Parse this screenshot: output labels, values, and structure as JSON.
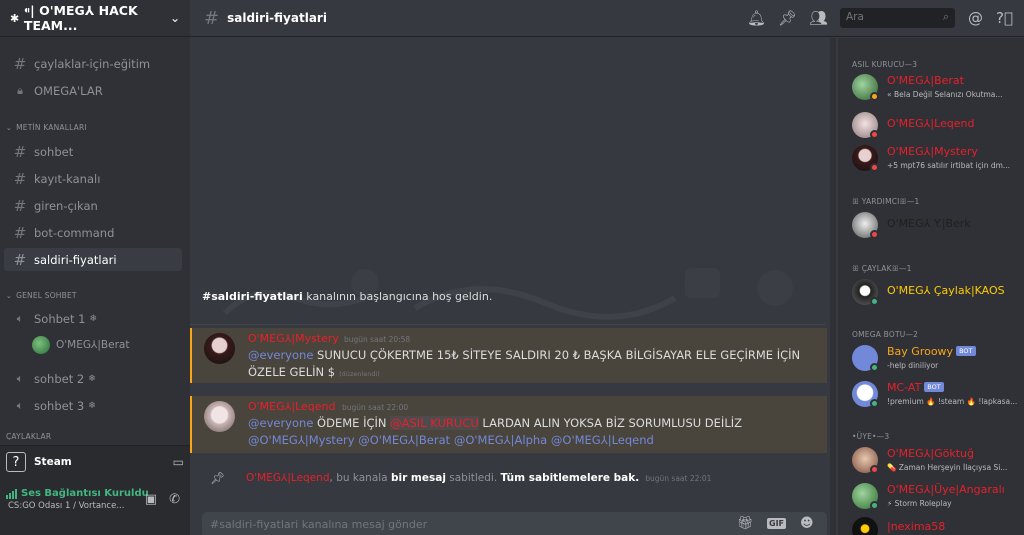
{
  "server": {
    "name": "⁌| O'MEG⅄ HACK TEAM..."
  },
  "channels_top": [
    {
      "name": "çaylaklar-için-eğitim",
      "icon": "hash-icon"
    },
    {
      "name": "OMEGA'LAR",
      "icon": "lock-icon"
    }
  ],
  "categories": {
    "text": "METİN KANALLARI",
    "voice": "GENEL SOHBET",
    "cut": "ÇAYLAKLAR"
  },
  "text_channels": [
    "sohbet",
    "kayıt-kanalı",
    "giren-çıkan",
    "bot-command",
    "saldiri-fiyatlari"
  ],
  "voice_channels": [
    {
      "name": "Sohbet 1",
      "member": "O'MEG⅄|Berat"
    },
    {
      "name": "sohbet 2"
    },
    {
      "name": "sohbet 3"
    }
  ],
  "activity": {
    "label": "Steam"
  },
  "voice_status": {
    "connected": "Ses Bağlantısı Kuruldu",
    "sub": "CS:GO Odası 1 / Vortance..."
  },
  "header": {
    "channel": "saldiri-fiyatlari"
  },
  "search": {
    "placeholder": "Ara"
  },
  "chat": {
    "welcome_channel": "#saldiri-fiyatlari",
    "welcome_text": " kanalının başlangıcına hoş geldin.",
    "messages": [
      {
        "author": "O'MEG⅄|Mystery",
        "time": "bugün saat 20:58",
        "mention": "@everyone",
        "text": " SUNUCU ÇÖKERTME 15₺ SİTEYE SALDIRI 20 ₺ BAŞKA BİLGİSAYAR ELE GEÇİRME İÇİN ÖZELE GELİN $",
        "edited": "(düzenlendi)"
      },
      {
        "author": "O'MEG⅄|Leqend",
        "time": "bugün saat 22:00",
        "mention": "@everyone",
        "text_a": " ÖDEME İÇİN ",
        "role_mention": "@ASIL KURUCU",
        "text_b": " LARDAN ALIN YOKSA BİZ SORUMLUSU DEİLİZ",
        "mentions_line2": "@O'MEG⅄|Mystery @O'MEG⅄|Berat @O'MEG⅄|Alpha @O'MEG⅄|Leqend"
      }
    ],
    "pin": {
      "author": "O'MEG⅄|Leqend",
      "t1": ", bu kanala ",
      "bold1": "bir mesaj",
      "t2": " sabitledi. ",
      "bold2": "Tüm sabitlemelere bak.",
      "time": "bugün saat 22:01"
    },
    "composer_placeholder": "#saldiri-fiyatlari kanalına mesaj gönder",
    "gif_label": "GIF"
  },
  "members": {
    "groups": [
      {
        "title": "ASIL KURUCU—3"
      },
      {
        "title": "ꕥ YARDIMCIꕥ—1"
      },
      {
        "title": "ꕥ ÇAYLAKꕥ—1"
      },
      {
        "title": "OMEGA BOTU—2"
      },
      {
        "title": "•ÜYE•—3"
      }
    ],
    "list": [
      {
        "name": "O'MEG⅄|Berat",
        "status": "« Bela Değil Selanızı Okutma...",
        "color": "#e8202a",
        "presence": "idle"
      },
      {
        "name": "O'MEG⅄|Leqend",
        "status": "",
        "color": "#e8202a",
        "presence": "dnd"
      },
      {
        "name": "O'MEG⅄|Mystery",
        "status": "+5 mpt76 satılır irtibat için dm...",
        "color": "#e8202a",
        "presence": "dnd"
      },
      {
        "name": "O'MEG⅄ Y.|Berk",
        "status": "",
        "color": "#222222",
        "presence": "dnd"
      },
      {
        "name": "O'MEG⅄ Çaylak|KAOS",
        "status": "",
        "color": "#ffcc00",
        "presence": "online"
      },
      {
        "name": "Bay Groowy",
        "status": "-help diniliyor",
        "color": "#faa61a",
        "presence": "online",
        "badge": "BOT"
      },
      {
        "name": "MC-AT",
        "status": "!premium 🔥 !steam 🔥 !lapkasa...",
        "color": "#e8202a",
        "presence": "online",
        "badge": "BOT"
      },
      {
        "name": "O'MEG⅄|Göktuğ",
        "status": "💊 Zaman Herşeyin İlaçıysa Si...",
        "color": "#e8202a",
        "presence": "dnd"
      },
      {
        "name": "O'MEG⅄|Üye|Angaralı",
        "status": "⚡ Storm Roleplay",
        "color": "#e8202a",
        "presence": "online"
      },
      {
        "name": "|nexima58",
        "status": "",
        "color": "#e8202a",
        "presence": "dnd"
      }
    ]
  },
  "colors": {
    "accent": "#7289da",
    "role_red": "#e8202a",
    "online": "#43b581",
    "dnd": "#f04747",
    "idle": "#faa61a",
    "mention_border": "#faa61a"
  }
}
